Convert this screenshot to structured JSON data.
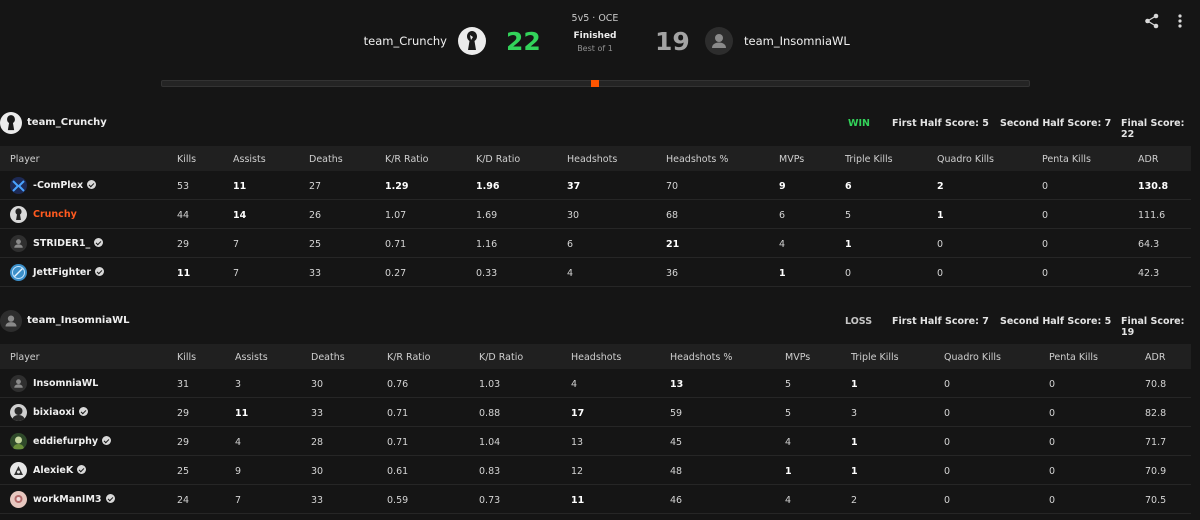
{
  "header": {
    "mode": "5v5 · OCE",
    "status": "Finished",
    "best_of": "Best of 1",
    "team_a": {
      "name": "team_Crunchy",
      "score": "22"
    },
    "team_b": {
      "name": "team_InsomniaWL",
      "score": "19"
    },
    "colors": {
      "win": "#32d35a",
      "accent": "#ff5500"
    }
  },
  "columns": [
    "Player",
    "Kills",
    "Assists",
    "Deaths",
    "K/R Ratio",
    "K/D Ratio",
    "Headshots",
    "Headshots %",
    "MVPs",
    "Triple Kills",
    "Quadro Kills",
    "Penta Kills",
    "ADR"
  ],
  "teams": [
    {
      "name": "team_Crunchy",
      "result": "WIN",
      "first_half": "First Half Score: 5",
      "second_half": "Second Half Score: 7",
      "final": "Final Score: 22",
      "players": [
        {
          "name": "-ComPlex",
          "avatar": "complex-logo-icon",
          "stats": [
            "53",
            "11",
            "27",
            "1.29",
            "1.96",
            "37",
            "70",
            "9",
            "6",
            "2",
            "0",
            "130.8"
          ]
        },
        {
          "name": "Crunchy",
          "avatar": "crunchy-avatar-icon",
          "stats": [
            "44",
            "14",
            "26",
            "1.07",
            "1.69",
            "30",
            "68",
            "6",
            "5",
            "1",
            "0",
            "111.6"
          ]
        },
        {
          "name": "STRIDER1_",
          "avatar": "default-user-icon",
          "stats": [
            "29",
            "7",
            "25",
            "0.71",
            "1.16",
            "6",
            "21",
            "4",
            "1",
            "0",
            "0",
            "64.3"
          ]
        },
        {
          "name": "JettFighter",
          "avatar": "jett-avatar-icon",
          "stats": [
            "11",
            "7",
            "33",
            "0.27",
            "0.33",
            "4",
            "36",
            "1",
            "0",
            "0",
            "0",
            "42.3"
          ]
        }
      ]
    },
    {
      "name": "team_InsomniaWL",
      "result": "LOSS",
      "first_half": "First Half Score: 7",
      "second_half": "Second Half Score: 5",
      "final": "Final Score: 19",
      "players": [
        {
          "name": "InsomniaWL",
          "avatar": "default-user-icon",
          "stats": [
            "31",
            "3",
            "30",
            "0.76",
            "1.03",
            "4",
            "13",
            "5",
            "1",
            "0",
            "0",
            "70.8"
          ]
        },
        {
          "name": "bixiaoxi",
          "avatar": "bixiaoxi-avatar-icon",
          "stats": [
            "29",
            "11",
            "33",
            "0.71",
            "0.88",
            "17",
            "59",
            "5",
            "3",
            "0",
            "0",
            "82.8"
          ]
        },
        {
          "name": "eddiefurphy",
          "avatar": "eddie-avatar-icon",
          "stats": [
            "29",
            "4",
            "28",
            "0.71",
            "1.04",
            "13",
            "45",
            "4",
            "1",
            "0",
            "0",
            "71.7"
          ]
        },
        {
          "name": "AlexieK",
          "avatar": "alexie-avatar-icon",
          "stats": [
            "25",
            "9",
            "30",
            "0.61",
            "0.83",
            "12",
            "48",
            "1",
            "1",
            "0",
            "0",
            "70.9"
          ]
        },
        {
          "name": "workManIM3",
          "avatar": "workman-avatar-icon",
          "stats": [
            "24",
            "7",
            "33",
            "0.59",
            "0.73",
            "11",
            "46",
            "4",
            "2",
            "0",
            "0",
            "70.5"
          ]
        }
      ]
    }
  ]
}
